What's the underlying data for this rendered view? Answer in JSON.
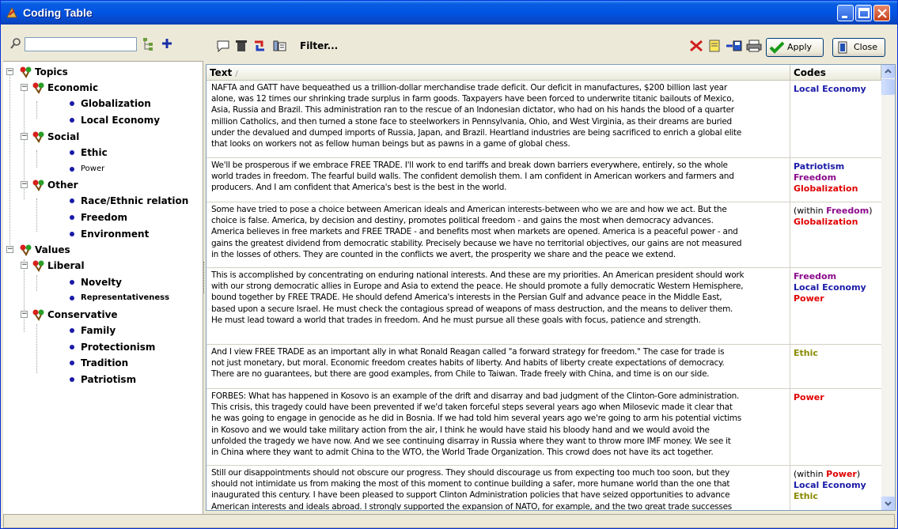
{
  "window": {
    "title": "Coding Table"
  },
  "search": {
    "value": ""
  },
  "toolbar": {
    "filter_label": "Filter...",
    "apply_label": "Apply",
    "close_label": "Close"
  },
  "tree": {
    "root1": "Topics",
    "economic": "Economic",
    "globalization": "Globalization",
    "local_economy": "Local Economy",
    "social": "Social",
    "ethic": "Ethic",
    "power": "Power",
    "other": "Other",
    "race": "Race/Ethnic relation",
    "freedom": "Freedom",
    "environment": "Environment",
    "root2": "Values",
    "liberal": "Liberal",
    "novelty": "Novelty",
    "representativeness": "Representativeness",
    "conservative": "Conservative",
    "family": "Family",
    "protectionism": "Protectionism",
    "tradition": "Tradition",
    "patriotism": "Patriotism"
  },
  "grid": {
    "col_text": "Text",
    "col_codes": "Codes",
    "rows": [
      {
        "text": "NAFTA and GATT have bequeathed us a trillion-dollar merchandise trade deficit. Our deficit in manufactures, $200 billion last year\nalone, was 12 times our shrinking trade surplus in farm goods. Taxpayers have been forced to underwrite titanic bailouts of Mexico,\nAsia, Russia and Brazil. This administration ran to the rescue of an Indonesian dictator, who had on his hands the blood of a quarter\nmillion Catholics, and then turned a stone face to steelworkers in Pennsylvania, Ohio, and West Virginia, as their dreams are buried\nunder the devalued and dumped imports of Russia, Japan, and Brazil. Heartland industries are being sacrificed to enrich a global elite\nthat looks on workers not as fellow human beings but as pawns in a game of global chess.",
        "codes": [
          {
            "label": "Local Economy",
            "color": "#1a1aa8"
          }
        ]
      },
      {
        "text": "We'll be prosperous if we embrace FREE TRADE. I'll work to end tariffs and break down barriers everywhere, entirely, so the whole\nworld trades in freedom. The fearful build walls. The confident demolish them. I am confident in American workers and farmers and\nproducers. And I am confident that America's best is the best in the world.",
        "codes": [
          {
            "label": "Patriotism",
            "color": "#1a1aa8"
          },
          {
            "label": "Freedom",
            "color": "#8b0a8b"
          },
          {
            "label": "Globalization",
            "color": "#e00000"
          }
        ]
      },
      {
        "text": "Some have tried to pose a choice between American ideals and American interests-between who we are and how we act. But the\nchoice is false. America, by decision and destiny, promotes political freedom - and gains the most when democracy advances.\nAmerica believes in free markets and FREE TRADE - and benefits most when markets are opened. America is a peaceful power - and\ngains the greatest dividend from democratic stability. Precisely because we have no territorial objectives, our gains are not measured\nin the losses of others. They are counted in the conflicts we avert, the prosperity we share and the peace we extend.",
        "within_prefix": "(within ",
        "within_code": "Freedom",
        "within_color": "#8b0a8b",
        "within_suffix": ")",
        "codes": [
          {
            "label": "Globalization",
            "color": "#e00000"
          }
        ]
      },
      {
        "text": "This is accomplished by concentrating on enduring national interests. And these are my priorities. An American president should work\nwith our strong democratic allies in Europe and Asia to extend the peace. He should promote a fully democratic Western Hemisphere,\nbound together by FREE TRADE. He should defend America's interests in the Persian Gulf and advance peace in the Middle East,\nbased upon a secure Israel. He must check the contagious spread of weapons of mass destruction, and the means to deliver them.\nHe must lead toward a world that trades in freedom. And he must pursue all these goals with focus, patience and strength.",
        "codes": [
          {
            "label": "Freedom",
            "color": "#8b0a8b"
          },
          {
            "label": "Local Economy",
            "color": "#1a1aa8"
          },
          {
            "label": "Power",
            "color": "#e00000"
          }
        ]
      },
      {
        "text": "And I view FREE TRADE as an important ally in what Ronald Reagan called \"a forward strategy for freedom.\" The case for trade is\nnot just monetary, but moral. Economic freedom creates habits of liberty. And habits of liberty create expectations of democracy.\nThere are no guarantees, but there are good examples, from Chile to Taiwan. Trade freely with China, and time is on our side.",
        "codes": [
          {
            "label": "Ethic",
            "color": "#8a8a00"
          }
        ]
      },
      {
        "text": "FORBES: What has happened in Kosovo is an example of the drift and disarray and bad judgment of the Clinton-Gore administration.\nThis crisis, this tragedy could have been prevented if we'd taken forceful steps several years ago when Milosevic made it clear that\nhe was going to engage in genocide as he did in Bosnia. If we had told him several years ago we're going to arm his potential victims\nin Kosovo and we would take military action from the air, I think he would have staid his bloody hand and we would avoid the\nunfolded the tragedy we have now. And we see continuing disarray in Russia where they want to throw more IMF money. We see it\nin China where they want to admit China to the WTO, the World Trade Organization. This crowd does not have its act together.",
        "codes": [
          {
            "label": "Power",
            "color": "#e00000"
          }
        ]
      },
      {
        "text": "Still our disappointments should not obscure our progress. They should discourage us from expecting too much too soon, but they\nshould not intimidate us from making the most of this moment to continue building a safer, more humane world than the one that\ninaugurated this century. I have been pleased to support Clinton Administration policies that have seized opportunities to advance\nAmerican interests and ideals abroad. I strongly supported the expansion of NATO, for example, and the two great trade successes",
        "within_prefix": "(within ",
        "within_code": "Power",
        "within_color": "#e00000",
        "within_suffix": ")",
        "codes": [
          {
            "label": "Local Economy",
            "color": "#1a1aa8"
          },
          {
            "label": "Ethic",
            "color": "#8a8a00"
          }
        ]
      }
    ]
  }
}
